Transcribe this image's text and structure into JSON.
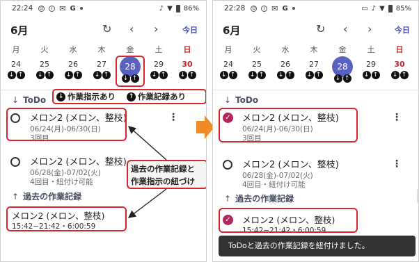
{
  "colors": {
    "accent": "#5a62c0",
    "highlight": "#d9232d",
    "check": "#b0285a",
    "sunday": "#c3272b",
    "arrow": "#f08a24"
  },
  "screens": [
    {
      "status": {
        "time": "22:24",
        "battery": "86%"
      },
      "header": {
        "month": "6月",
        "refresh_icon": "refresh-icon",
        "prev_icon": "chevron-left-icon",
        "next_icon": "chevron-right-icon",
        "today": "今日"
      },
      "weekdays": [
        "月",
        "火",
        "水",
        "木",
        "金",
        "土",
        "日"
      ],
      "dates": [
        "24",
        "25",
        "26",
        "27",
        "28",
        "29",
        "30"
      ],
      "todo_section": "ToDo",
      "todos": [
        {
          "title": "メロン2 (メロン、整枝)",
          "period": "06/24(月)-06/30(日)",
          "meta": "3回目"
        },
        {
          "title": "メロン2 (メロン、整枝)",
          "period": "06/28(金)-07/02(火)",
          "meta": "4回目・紐付け可能"
        }
      ],
      "records_section": "過去の作業記録",
      "records": [
        {
          "title": "メロン2 (メロン、整枝)",
          "time": "15:42−21:42・6:00:59"
        }
      ],
      "legend": {
        "instruction": "作業指示あり",
        "record": "作業記録あり"
      },
      "callout": {
        "line1": "過去の作業記録と",
        "line2": "作業指示の紐づけ"
      }
    },
    {
      "status": {
        "time": "22:28",
        "battery": "85%"
      },
      "header": {
        "month": "6月",
        "today": "今日"
      },
      "weekdays": [
        "月",
        "火",
        "水",
        "木",
        "金",
        "土",
        "日"
      ],
      "dates": [
        "24",
        "25",
        "26",
        "27",
        "28",
        "29",
        "30"
      ],
      "todo_section": "ToDo",
      "todos": [
        {
          "title": "メロン2 (メロン、整枝)",
          "period": "06/24(月)-06/30(日)",
          "meta": "3回目"
        },
        {
          "title": "メロン2 (メロン、整枝)",
          "period": "06/28(金)-07/02(火)",
          "meta": "4回目・紐付け可能"
        }
      ],
      "records_section": "過去の作業記録",
      "records": [
        {
          "title": "メロン2 (メロン、整枝)",
          "time": "15:42−21:42・6:00:59"
        }
      ],
      "snackbar": "ToDoと過去の作業記録を紐付けました。"
    }
  ]
}
